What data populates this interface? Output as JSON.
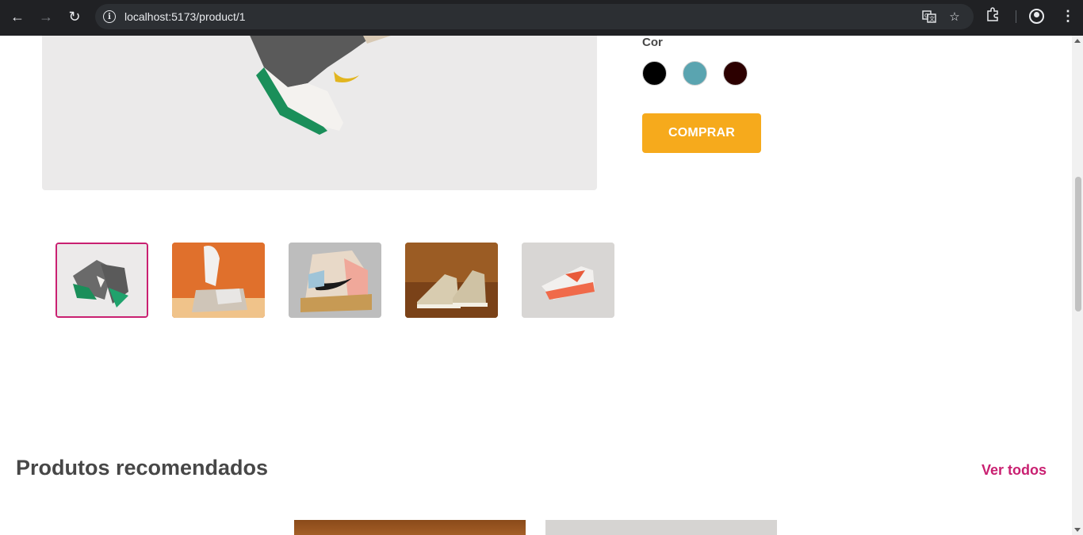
{
  "browser": {
    "url": "localhost:5173/product/1"
  },
  "product": {
    "color_label": "Cor",
    "colors": [
      "#000000",
      "#5aa4b0",
      "#2c0000"
    ],
    "buy_label": "COMPRAR"
  },
  "accent_colors": {
    "primary": "#c92071",
    "buy_button": "#f6aa1c"
  },
  "recommended": {
    "title": "Produtos recomendados",
    "see_all_label": "Ver todos"
  }
}
